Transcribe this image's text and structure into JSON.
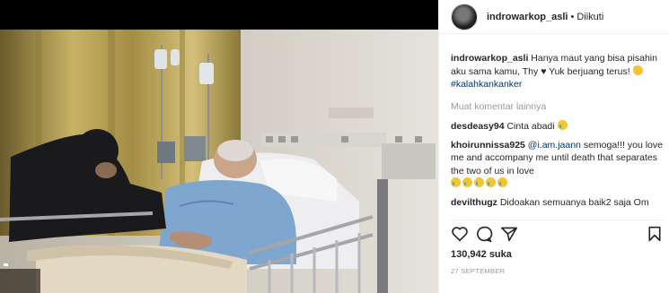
{
  "photo": {
    "alt_icon": "instagram-photo"
  },
  "header": {
    "username": "indrowarkop_asli",
    "separator": "•",
    "follow_status": "Diikuti"
  },
  "caption": {
    "username": "indrowarkop_asli",
    "text_part1": "Hanya maut yang bisa pisahin aku sama kamu, Thy",
    "text_part2": "Yuk berjuang terus!",
    "hashtag": "#kalahkankanker"
  },
  "more_comments": "Muat komentar lainnya",
  "comments": [
    {
      "username": "desdeasy94",
      "text": "Cinta abadi"
    },
    {
      "username": "khoirunnissa925",
      "mention": "@i.am.jaann",
      "text": "semoga!!! you love me and accompany me until death that separates the two of us in love"
    },
    {
      "username": "devilthugz",
      "text": "Didoakan semuanya baik2 saja Om"
    }
  ],
  "likes": "130,942 suka",
  "date": "27 SEPTEMBER",
  "icons": [
    "heart-outline-icon",
    "comment-icon",
    "share-icon",
    "bookmark-icon"
  ]
}
